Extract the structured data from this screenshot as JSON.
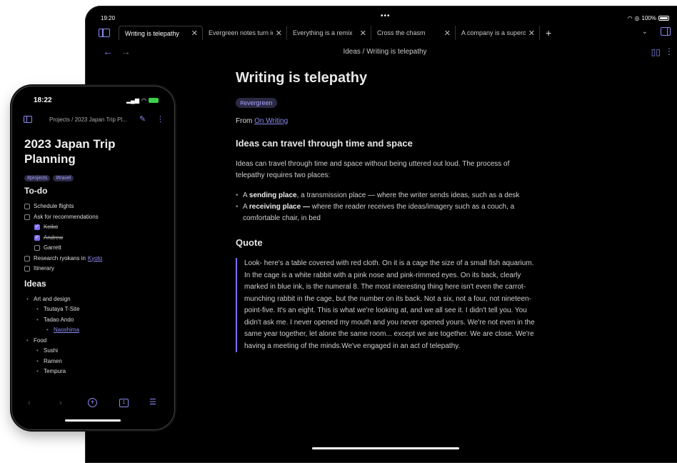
{
  "ipad": {
    "status": {
      "time": "19:20",
      "dots": "•••",
      "battery": "100%"
    },
    "tabs": [
      {
        "label": "Writing is telepathy",
        "active": true
      },
      {
        "label": "Evergreen notes turn ide",
        "active": false
      },
      {
        "label": "Everything is a remix",
        "active": false
      },
      {
        "label": "Cross the chasm",
        "active": false
      },
      {
        "label": "A company is a superorg",
        "active": false
      }
    ],
    "breadcrumb": "Ideas / Writing is telepathy",
    "note": {
      "title": "Writing is telepathy",
      "tag": "#evergreen",
      "from_prefix": "From ",
      "from_link": "On Writing",
      "h_ideas": "Ideas can travel through time and space",
      "p_ideas": "Ideas can travel through time and space without being uttered out loud. The process of telepathy requires two places:",
      "bullets": [
        {
          "pre": "A ",
          "bold": "sending place",
          "rest": ", a transmission place — where the writer sends ideas, such as a desk"
        },
        {
          "pre": "A ",
          "bold": "receiving place —",
          "rest": " where the reader receives the ideas/imagery such as a couch, a comfortable chair, in bed"
        }
      ],
      "h_quote": "Quote",
      "quote": "Look- here's a table covered with red cloth. On it is a cage the size of a small fish aquarium. In the cage is a white rabbit with a pink nose and pink-rimmed eyes. On its back, clearly marked in blue ink, is the numeral 8. The most interesting thing here isn't even the carrot-munching rabbit in the cage, but the number on its back. Not a six, not a four, not nineteen-point-five. It's an eight. This is what we're looking at, and we all see it. I didn't tell you. You didn't ask me. I never opened my mouth and you never opened yours. We're not even in the same year together, let alone the same room... except we are together. We are close. We're having a meeting of the minds.We've engaged in an act of telepathy."
    }
  },
  "iphone": {
    "status": {
      "time": "18:22"
    },
    "breadcrumb": "Projects / 2023 Japan Trip Pl...",
    "title": "2023 Japan Trip Planning",
    "tags": [
      "#projects",
      "#travel"
    ],
    "h_todo": "To-do",
    "todos": [
      {
        "label": "Schedule flights",
        "checked": false,
        "sub": false
      },
      {
        "label": "Ask for recommendations",
        "checked": false,
        "sub": false
      },
      {
        "label": "Keiko",
        "checked": true,
        "sub": true
      },
      {
        "label": "Andrew",
        "checked": true,
        "sub": true
      },
      {
        "label": "Garrett",
        "checked": false,
        "sub": true
      },
      {
        "label": "Research ryokans in",
        "link": "Kyoto",
        "checked": false,
        "sub": false
      },
      {
        "label": "Itinerary",
        "checked": false,
        "sub": false
      }
    ],
    "h_ideas": "Ideas",
    "ideas": [
      {
        "label": "Art and design",
        "level": 1
      },
      {
        "label": "Tsutaya T-Site",
        "level": 2
      },
      {
        "label": "Tadao Ando",
        "level": 2
      },
      {
        "label": "Naoshima",
        "level": 3,
        "link": true
      },
      {
        "label": "Food",
        "level": 1
      },
      {
        "label": "Sushi",
        "level": 2
      },
      {
        "label": "Ramen",
        "level": 2
      },
      {
        "label": "Tempura",
        "level": 2
      }
    ],
    "toolbar": {
      "tabs_count": "1"
    }
  }
}
